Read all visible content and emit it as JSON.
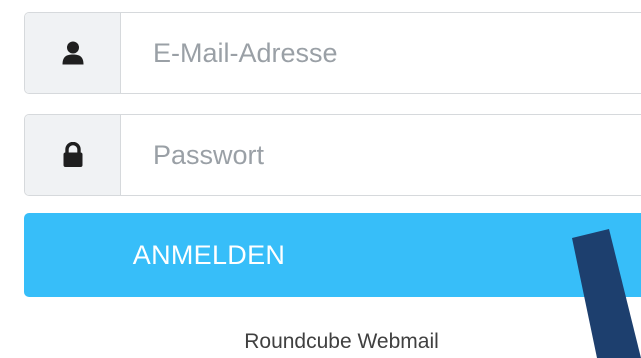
{
  "login_form": {
    "username": {
      "icon": "user-icon",
      "placeholder": "E-Mail-Adresse",
      "value": ""
    },
    "password": {
      "icon": "lock-icon",
      "placeholder": "Passwort",
      "value": ""
    },
    "submit_label": "ANMELDEN",
    "button_color": "#37bef9"
  },
  "footer": {
    "product_name": "Roundcube Webmail"
  },
  "overlay": {
    "stroke_color": "#1d3f6e"
  }
}
